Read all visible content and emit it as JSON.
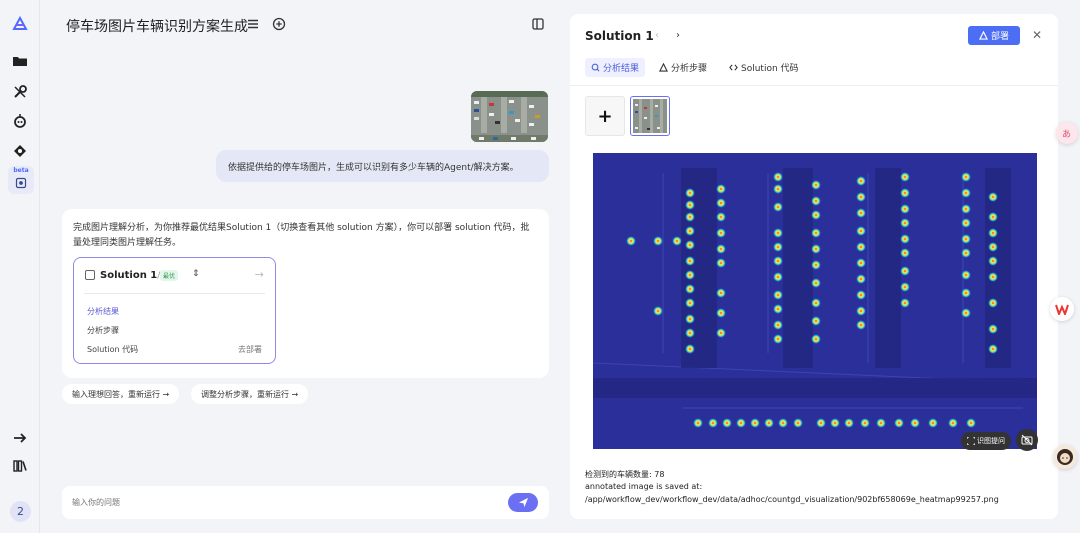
{
  "chat": {
    "title": "停车场图片车辆识别方案生成",
    "user_message": "依据提供给的停车场图片，生成可以识别有多少车辆的Agent/解决方案。",
    "ai_message": "完成图片理解分析，为你推荐最优结果Solution 1（切换查看其他 solution 方案），你可以部署 solution 代码，批量处理同类图片理解任务。",
    "solution_card": {
      "title": "Solution 1",
      "fraction": "/2",
      "badge": "最优",
      "items": [
        "分析结果",
        "分析步骤",
        "Solution 代码"
      ],
      "deploy_link": "去部署"
    },
    "chips": [
      "输入理想回答，重新运行 →",
      "调整分析步骤，重新运行 →"
    ],
    "input_placeholder": "输入你的问题"
  },
  "rail": {
    "beta_label": "beta",
    "user_badge": "2",
    "icons": [
      "logo-icon",
      "folder-icon",
      "tools-icon",
      "agent-icon",
      "plugin-icon",
      "beta-app-icon",
      "expand-arrow-icon",
      "library-icon"
    ]
  },
  "panel": {
    "title": "Solution 1",
    "deploy_label": "部署",
    "tabs": [
      "分析结果",
      "分析步骤",
      "Solution 代码"
    ],
    "result_count": "检测到的车辆数量: 78",
    "saved_label": "annotated image is saved at:",
    "saved_path": "/app/workflow_dev/workflow_dev/data/adhoc/countgd_visualization/902bf658069e_heatmap99257.png"
  },
  "floating": {
    "ask_label": "识图提问"
  },
  "colors": {
    "accent": "#4c6ef5",
    "heatmap_bg": "#2a2f9a",
    "send": "#6b6ff3"
  }
}
